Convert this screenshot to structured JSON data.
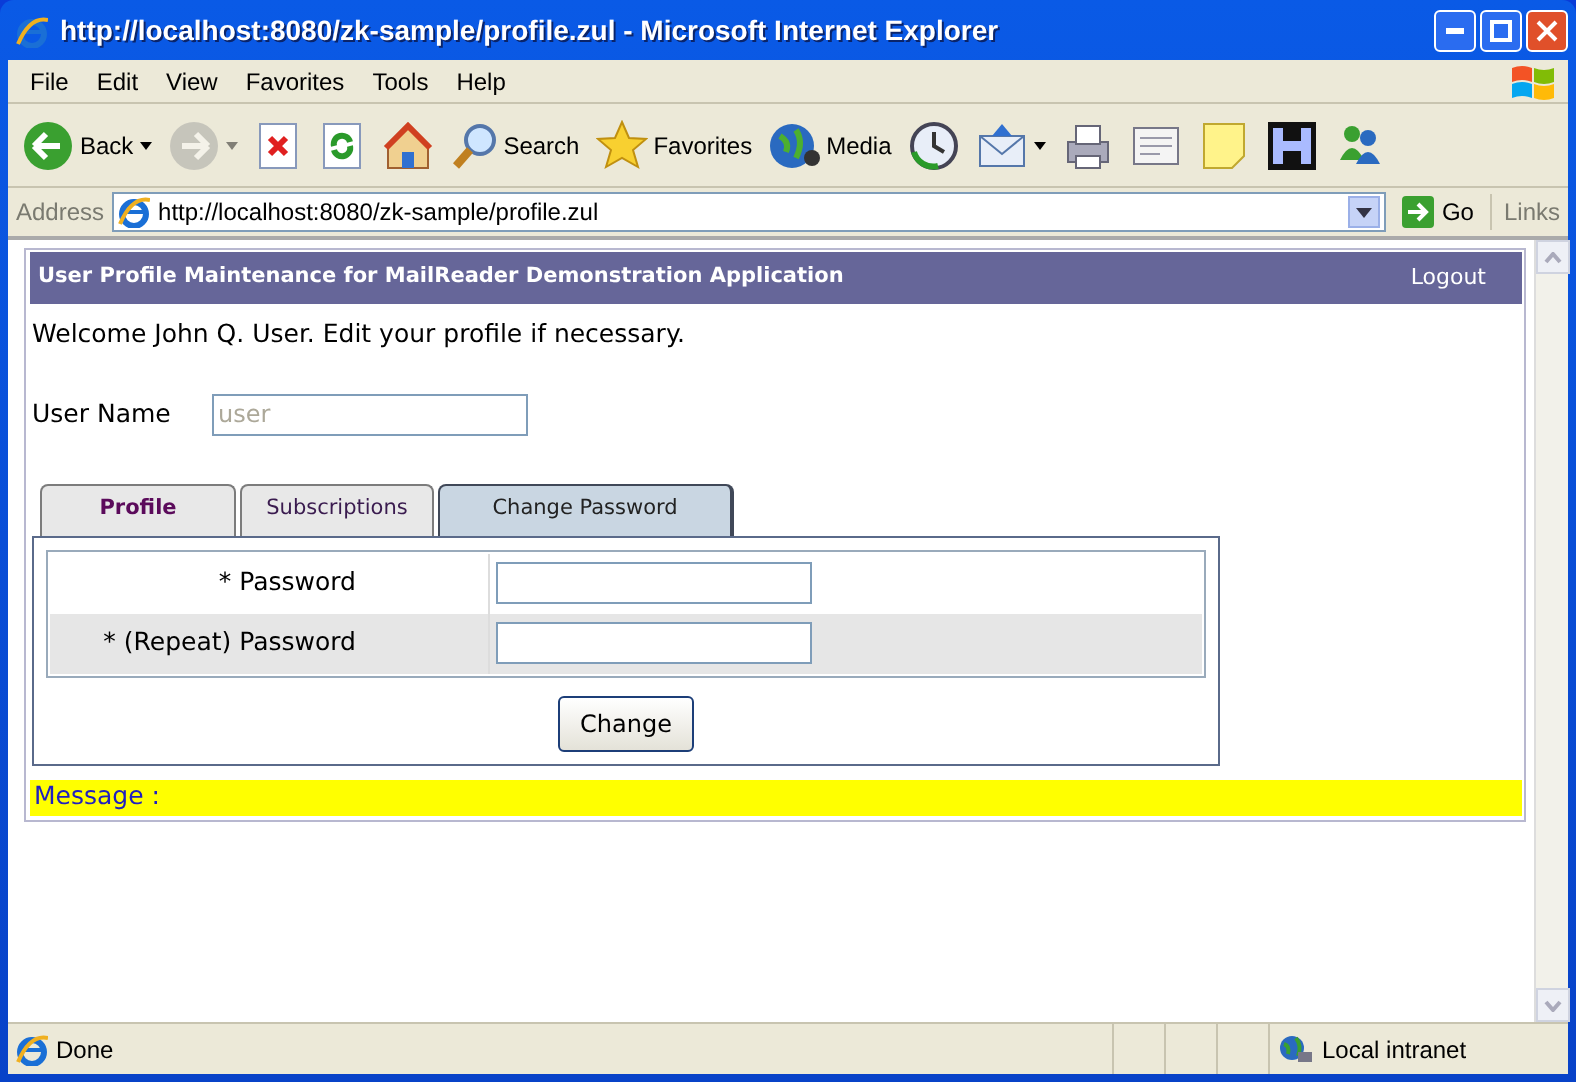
{
  "window": {
    "title": "http://localhost:8080/zk-sample/profile.zul - Microsoft Internet Explorer"
  },
  "menu": [
    "File",
    "Edit",
    "View",
    "Favorites",
    "Tools",
    "Help"
  ],
  "toolbar": [
    {
      "kind": "back",
      "label": "Back",
      "dropdown": true,
      "disabled": false
    },
    {
      "kind": "forward",
      "dropdown": true,
      "disabled": true
    },
    {
      "kind": "stop",
      "dropdown": false,
      "disabled": false
    },
    {
      "kind": "refresh",
      "dropdown": false,
      "disabled": false
    },
    {
      "kind": "home",
      "dropdown": false,
      "disabled": false
    },
    {
      "kind": "search",
      "label": "Search",
      "dropdown": false,
      "disabled": false
    },
    {
      "kind": "favorites",
      "label": "Favorites",
      "dropdown": false,
      "disabled": false
    },
    {
      "kind": "media",
      "label": "Media",
      "dropdown": false,
      "disabled": false
    },
    {
      "kind": "history",
      "dropdown": false,
      "disabled": false
    },
    {
      "kind": "mail",
      "dropdown": true,
      "disabled": false
    },
    {
      "kind": "print",
      "dropdown": false,
      "disabled": false
    },
    {
      "kind": "edit",
      "dropdown": false,
      "disabled": false
    },
    {
      "kind": "note",
      "dropdown": false,
      "disabled": false
    },
    {
      "kind": "h",
      "dropdown": false,
      "disabled": false
    },
    {
      "kind": "messenger",
      "dropdown": false,
      "disabled": false
    }
  ],
  "address_bar": {
    "label": "Address",
    "url": "http://localhost:8080/zk-sample/profile.zul",
    "go": "Go",
    "links": "Links"
  },
  "page": {
    "header": {
      "title": "User Profile Maintenance for MailReader Demonstration Application",
      "logout": "Logout"
    },
    "welcome": "Welcome John Q. User. Edit your profile if necessary.",
    "user_name": {
      "label": "User Name",
      "value": "user",
      "disabled": true
    },
    "tabs": [
      {
        "label": "Profile",
        "selected": false,
        "emphasized": true
      },
      {
        "label": "Subscriptions",
        "selected": false,
        "emphasized": false
      },
      {
        "label": "Change Password",
        "selected": true,
        "emphasized": false
      }
    ],
    "form_rows": [
      {
        "label": "* Password"
      },
      {
        "label": "* (Repeat) Password"
      }
    ],
    "submit": "Change",
    "message": "Message :"
  },
  "status_bar": {
    "text": "Done",
    "zone": "Local intranet"
  }
}
